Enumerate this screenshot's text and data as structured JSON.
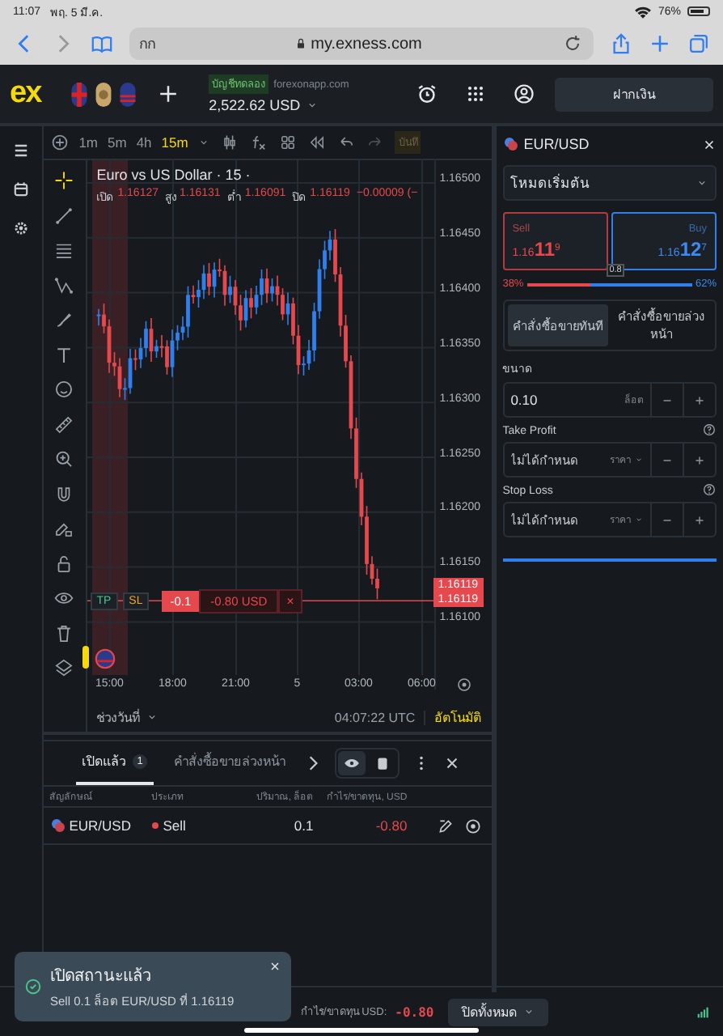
{
  "status_bar": {
    "time": "11:07",
    "date": "พฤ. 5 มี.ค.",
    "battery": "76%"
  },
  "browser": {
    "tab_text": "กก",
    "url": "my.exness.com"
  },
  "header": {
    "logo": "ex",
    "account_type": "บัญชีทดลอง",
    "server": "forexonapp.com",
    "balance": "2,522.62 USD",
    "deposit_button": "ฝากเงิน"
  },
  "toolbar": {
    "timeframes": [
      {
        "label": "1m",
        "selected": false
      },
      {
        "label": "5m",
        "selected": false
      },
      {
        "label": "4h",
        "selected": false
      },
      {
        "label": "15m",
        "selected": true
      }
    ],
    "save_label": "บันทึ"
  },
  "chart": {
    "title": "Euro vs US Dollar · 15 ·",
    "ohlc": [
      {
        "label": "เปิด",
        "value": "1.16127"
      },
      {
        "label": "สูง",
        "value": "1.16131"
      },
      {
        "label": "ต่ำ",
        "value": "1.16091"
      },
      {
        "label": "ปิด",
        "value": "1.16119"
      }
    ],
    "change": "−0.00009 (−",
    "price_ticks": [
      "1.16500",
      "1.16450",
      "1.16400",
      "1.16350",
      "1.16300",
      "1.16250",
      "1.16200",
      "1.16150",
      "1.16100"
    ],
    "price_tags": [
      "1.16119",
      "1.16119"
    ],
    "time_ticks": [
      "15:00",
      "18:00",
      "21:00",
      "5",
      "03:00",
      "06:00"
    ],
    "position": {
      "tp": "TP",
      "sl": "SL",
      "volume": "-0.1",
      "pnl": "-0.80 USD",
      "close": "×"
    },
    "range_button": "ช่วงวันที่",
    "clock": "04:07:22 UTC",
    "auto_label": "อัตโนมัติ"
  },
  "order_panel": {
    "symbol": "EUR/USD",
    "mode": "โหมดเริ่มต้น",
    "sell": {
      "label": "Sell",
      "price_main": "1.16",
      "price_big": "11",
      "price_sup": "9"
    },
    "buy": {
      "label": "Buy",
      "price_main": "1.16",
      "price_big": "12",
      "price_sup": "7"
    },
    "spread": "0.8",
    "sell_share": "38%",
    "buy_share": "62%",
    "sentiment": {
      "level": 0.38
    },
    "order_tabs": [
      {
        "label": "คำสั่งซื้อขายทันที",
        "selected": true
      },
      {
        "label": "คำสั่งซื้อขายล่วงหน้า",
        "selected": false
      }
    ],
    "volume": {
      "label": "ขนาด",
      "value": "0.10",
      "unit": "ล็อต"
    },
    "fields": [
      {
        "label": "Take Profit",
        "placeholder": "ไม่ได้กำหนด",
        "unit": "ราคา"
      },
      {
        "label": "Stop Loss",
        "placeholder": "ไม่ได้กำหนด",
        "unit": "ราคา"
      }
    ]
  },
  "positions": {
    "tabs": [
      {
        "label": "เปิดแล้ว",
        "count": "1",
        "selected": true
      },
      {
        "label": "คำสั่งซื้อขายล่วงหน้า",
        "selected": false
      }
    ],
    "view_toggle": [
      {
        "selected": true
      },
      {
        "selected": false
      }
    ],
    "columns": [
      "สัญลักษณ์",
      "ประเภท",
      "ปริมาณ, ล็อต",
      "กำไร/ขาดทุน, USD"
    ],
    "rows": [
      {
        "symbol": "EUR/USD",
        "type": "Sell",
        "volume": "0.1",
        "profit": "-0.80"
      }
    ]
  },
  "footer": {
    "pnl_label": "กำไร/ขาดทุน USD:",
    "pnl": "-0.80",
    "close_all": "ปิดทั้งหมด"
  },
  "toast": {
    "title": "เปิดสถานะแล้ว",
    "message": "Sell 0.1 ล็อต EUR/USD ที่ 1.16119"
  }
}
